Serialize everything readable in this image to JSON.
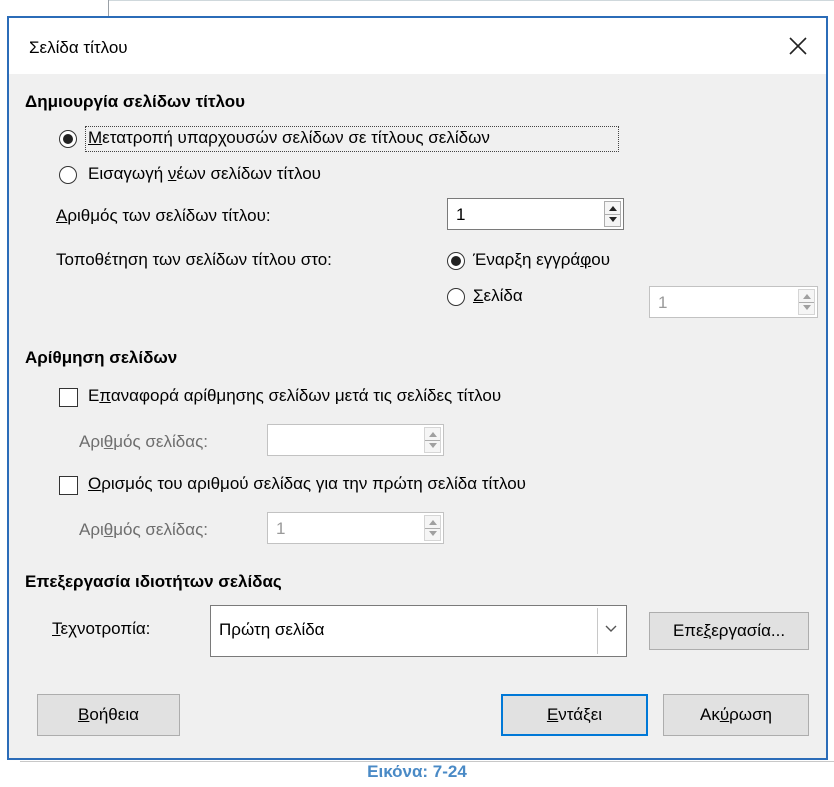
{
  "dialog": {
    "title": "Σελίδα τίτλου"
  },
  "creation": {
    "heading": "Δημιουργία σελίδων τίτλου",
    "convert_option": {
      "pre": "",
      "acc": "Μ",
      "post": "ετατροπή υπαρχουσών σελίδων σε τίτλους σελίδων",
      "checked": true
    },
    "insert_option": {
      "pre": "Εισαγωγή ",
      "acc": "ν",
      "post": "έων σελίδων τίτλου",
      "checked": false
    },
    "count_label": {
      "pre": "",
      "acc": "Α",
      "post": "ριθμός των σελίδων τίτλου:"
    },
    "count_value": "1",
    "place_label": "Τοποθέτηση των σελίδων τίτλου στο:",
    "place_start": {
      "pre": "Έναρξη εγγρά",
      "acc": "φ",
      "post": "ου",
      "checked": true
    },
    "place_page": {
      "pre": "",
      "acc": "Σ",
      "post": "ελίδα",
      "checked": false
    },
    "place_page_value": "1"
  },
  "numbering": {
    "heading": "Αρίθμηση σελίδων",
    "reset": {
      "pre": "Ε",
      "acc": "π",
      "post": "αναφορά αρίθμησης σελίδων μετά τις σελίδες τίτλου",
      "checked": false
    },
    "reset_number_label": {
      "pre": "Αρι",
      "acc": "θ",
      "post": "μός σελίδας:"
    },
    "reset_number_value": "",
    "set_first": {
      "pre": "",
      "acc": "Ο",
      "post": "ρισμός του αριθμού σελίδας για την πρώτη σελίδα τίτλου",
      "checked": false
    },
    "first_number_label": {
      "pre": "Αρι",
      "acc": "θ",
      "post": "μός σελίδας:"
    },
    "first_number_value": "1"
  },
  "properties": {
    "heading": "Επεξεργασία ιδιοτήτων σελίδας",
    "style_label": {
      "pre": "",
      "acc": "Τ",
      "post": "εχνοτροπία:"
    },
    "style_value": "Πρώτη σελίδα",
    "edit_button": {
      "pre": "Επε",
      "acc": "ξ",
      "post": "εργασία..."
    }
  },
  "footer": {
    "help": {
      "pre": "",
      "acc": "Β",
      "post": "οήθεια"
    },
    "ok": {
      "pre": "",
      "acc": "Ε",
      "post": "ντάξει"
    },
    "cancel": {
      "pre": "Ακ",
      "acc": "ύ",
      "post": "ρωση"
    }
  },
  "caption": "Εικόνα: 7-24",
  "colors": {
    "accent": "#0078d7",
    "caption": "#4a8ac6",
    "dialog_border": "#2b6cb8"
  },
  "icons": {
    "close": "close-icon",
    "spin": "spin-arrows-icon",
    "dropdown": "chevron-down-icon"
  }
}
